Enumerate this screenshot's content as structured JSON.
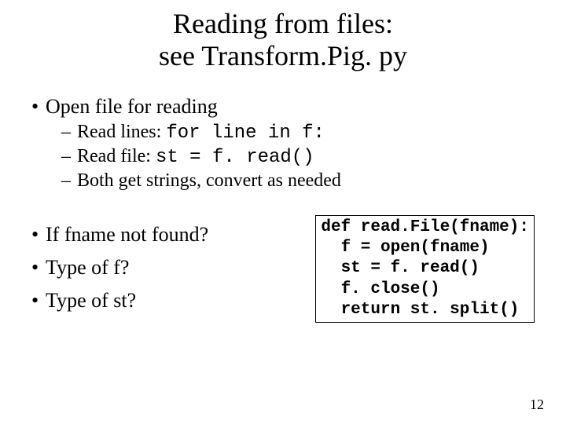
{
  "title": {
    "line1": "Reading from files:",
    "line2": "see Transform.Pig. py"
  },
  "bullets": [
    {
      "text": "Open file for reading",
      "sub": [
        {
          "prefix": "Read lines: ",
          "code": "for line in f:"
        },
        {
          "prefix": "Read file: ",
          "code": "st = f. read()"
        },
        {
          "text": "Both get strings, convert as needed"
        }
      ]
    },
    {
      "text": "If fname not found?"
    },
    {
      "text": "Type of f?"
    },
    {
      "text": "Type of st?"
    }
  ],
  "code": {
    "line1": "def read.File(fname):",
    "line2": "f = open(fname)",
    "line3": "st = f. read()",
    "line4": "f. close()",
    "line5": "return st. split()"
  },
  "page_number": "12"
}
